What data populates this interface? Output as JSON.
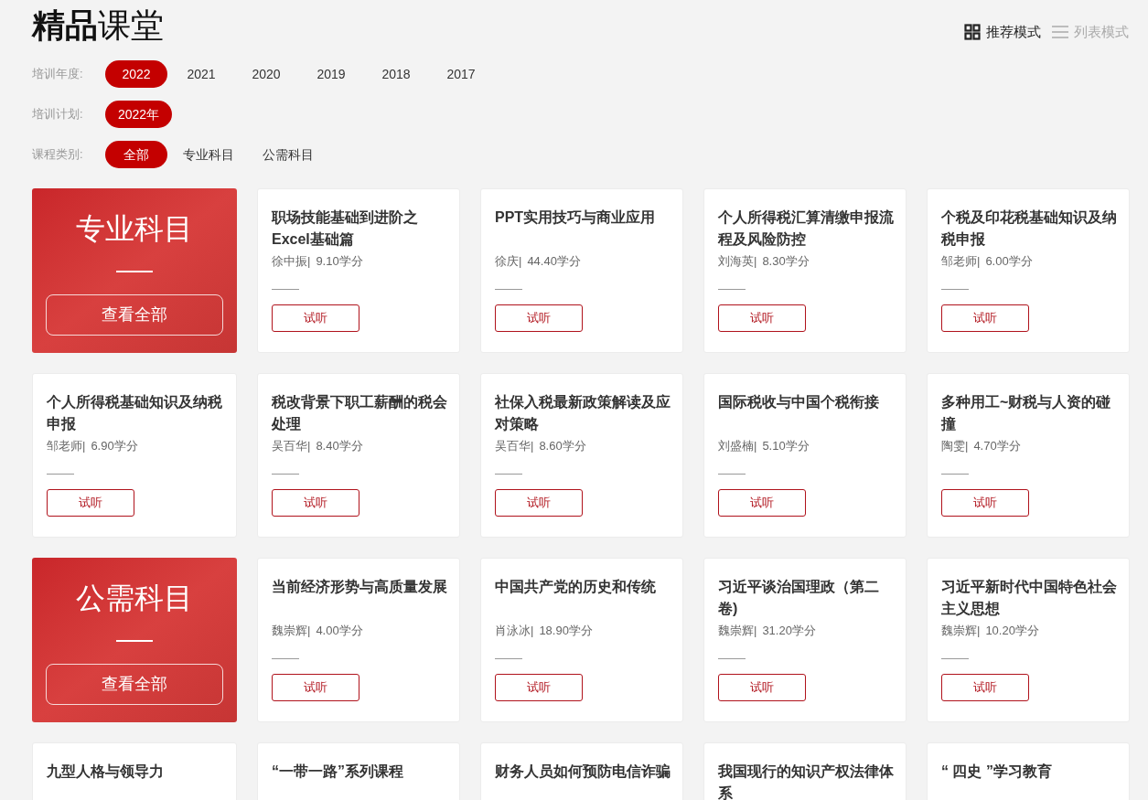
{
  "title": "**精品**课堂",
  "view_modes": [
    {
      "label": "推荐模式",
      "kind": "grid",
      "selected": true
    },
    {
      "label": "列表模式",
      "kind": "list",
      "selected": false
    }
  ],
  "filters": [
    {
      "label": "培训年度:",
      "options": [
        {
          "label": "2022",
          "selected": true
        },
        {
          "label": "2021",
          "selected": false
        },
        {
          "label": "2020",
          "selected": false
        },
        {
          "label": "2019",
          "selected": false
        },
        {
          "label": "2018",
          "selected": false
        },
        {
          "label": "2017",
          "selected": false
        }
      ]
    },
    {
      "label": "培训计划:",
      "options": [
        {
          "label": "2022年",
          "selected": true
        }
      ]
    },
    {
      "label": "课程类别:",
      "options": [
        {
          "label": "全部",
          "selected": true
        },
        {
          "label": "专业科目",
          "selected": false
        },
        {
          "label": "公需科目",
          "selected": false
        }
      ]
    }
  ],
  "cards": [
    {
      "kind": "category",
      "title": "专业科目",
      "button": "查看全部"
    },
    {
      "kind": "course",
      "title": "职场技能基础到进阶之Excel基础篇",
      "teacher": "徐中振|",
      "credits": "9.10学分",
      "button": "试听"
    },
    {
      "kind": "course",
      "title": "PPT实用技巧与商业应用",
      "teacher": "徐庆|",
      "credits": "44.40学分",
      "button": "试听"
    },
    {
      "kind": "course",
      "title": "个人所得税汇算清缴申报流程及风险防控",
      "teacher": "刘海英|",
      "credits": "8.30学分",
      "button": "试听"
    },
    {
      "kind": "course",
      "title": "个税及印花税基础知识及纳税申报",
      "teacher": "邹老师|",
      "credits": "6.00学分",
      "button": "试听"
    },
    {
      "kind": "course",
      "title": "个人所得税基础知识及纳税申报",
      "teacher": "邹老师|",
      "credits": "6.90学分",
      "button": "试听"
    },
    {
      "kind": "course",
      "title": "税改背景下职工薪酬的税会处理",
      "teacher": "吴百华|",
      "credits": "8.40学分",
      "button": "试听"
    },
    {
      "kind": "course",
      "title": "社保入税最新政策解读及应对策略",
      "teacher": "吴百华|",
      "credits": "8.60学分",
      "button": "试听"
    },
    {
      "kind": "course",
      "title": "国际税收与中国个税衔接",
      "teacher": "刘盛楠|",
      "credits": "5.10学分",
      "button": "试听"
    },
    {
      "kind": "course",
      "title": "多种用工~财税与人资的碰撞",
      "teacher": "陶雯|",
      "credits": "4.70学分",
      "button": "试听"
    },
    {
      "kind": "category",
      "title": "公需科目",
      "button": "查看全部"
    },
    {
      "kind": "course",
      "title": "当前经济形势与高质量发展",
      "teacher": "魏崇辉|",
      "credits": "4.00学分",
      "button": "试听"
    },
    {
      "kind": "course",
      "title": "中国共产党的历史和传统",
      "teacher": "肖泳冰|",
      "credits": "18.90学分",
      "button": "试听"
    },
    {
      "kind": "course",
      "title": "习近平谈治国理政（第二卷)",
      "teacher": "魏崇辉|",
      "credits": "31.20学分",
      "button": "试听"
    },
    {
      "kind": "course",
      "title": "习近平新时代中国特色社会主义思想",
      "teacher": "魏崇辉|",
      "credits": "10.20学分",
      "button": "试听"
    },
    {
      "kind": "course",
      "title": "九型人格与领导力"
    },
    {
      "kind": "course",
      "title": "“一带一路”系列课程"
    },
    {
      "kind": "course",
      "title": "财务人员如何预防电信诈骗"
    },
    {
      "kind": "course",
      "title": "我国现行的知识产权法律体系"
    },
    {
      "kind": "course",
      "title": "“ 四史 ”学习教育"
    }
  ]
}
